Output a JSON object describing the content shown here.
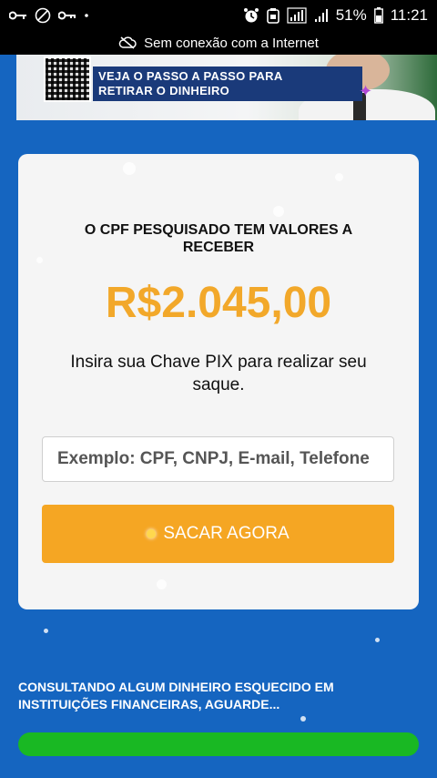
{
  "status_bar": {
    "battery": "51%",
    "time": "11:21"
  },
  "offline_notice": "Sem conexão com a Internet",
  "banner": {
    "caption_line1": "VEJA O PASSO A PASSO PARA",
    "caption_line2": "RETIRAR O DINHEIRO"
  },
  "card": {
    "title": "O CPF PESQUISADO TEM VALORES A RECEBER",
    "amount": "R$2.045,00",
    "instruction": "Insira sua Chave PIX para realizar seu saque.",
    "pix_placeholder": "Exemplo: CPF, CNPJ, E-mail, Telefone",
    "cta_label": "SACAR AGORA"
  },
  "footer": {
    "consulting_text": "CONSULTANDO ALGUM DINHEIRO ESQUECIDO EM INSTITUIÇÕES FINANCEIRAS, AGUARDE...",
    "progress": 1.0
  },
  "colors": {
    "background": "#1565c0",
    "amount": "#f2a82a",
    "cta": "#f5a623",
    "progress": "#19b823"
  }
}
